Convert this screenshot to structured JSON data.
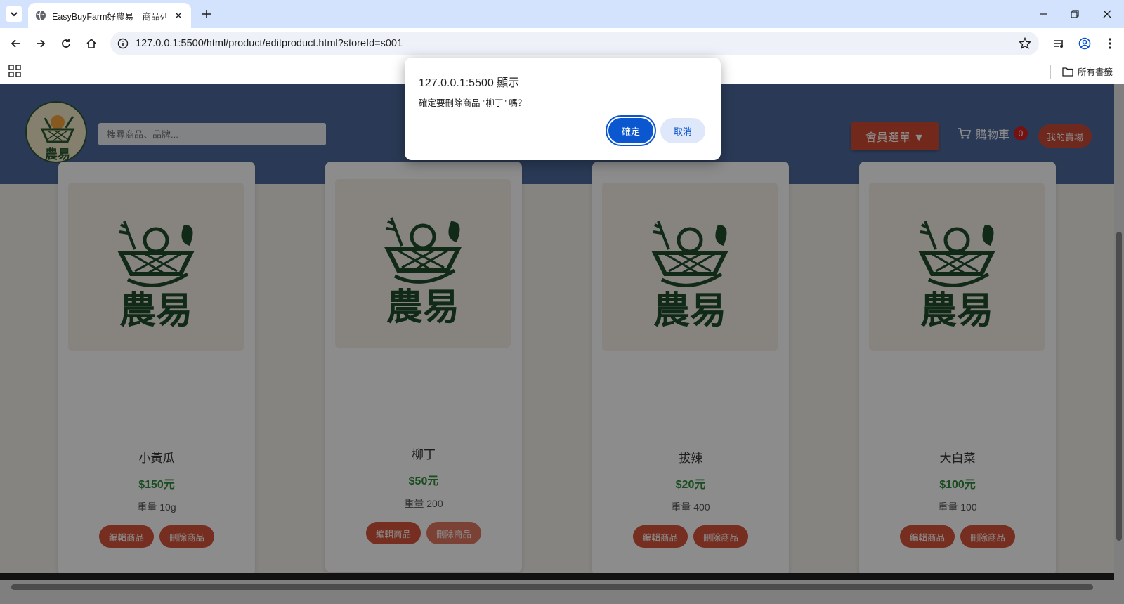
{
  "browser": {
    "tab_title": "EasyBuyFarm好農易｜商品列表",
    "url": "127.0.0.1:5500/html/product/editproduct.html?storeId=s001",
    "bookmark_folder": "所有書籤"
  },
  "header": {
    "logo_text": "農易",
    "search_placeholder": "搜尋商品、品牌...",
    "member_menu": "會員選單 ▼",
    "cart_label": "購物車",
    "cart_count": "0",
    "my_shop": "我的賣場"
  },
  "products": [
    {
      "name": "小黃瓜",
      "price": "$150元",
      "weight": "重量 10g",
      "edit": "編輯商品",
      "delete": "刪除商品",
      "logo": "農易"
    },
    {
      "name": "柳丁",
      "price": "$50元",
      "weight": "重量 200",
      "edit": "編輯商品",
      "delete": "刪除商品",
      "logo": "農易"
    },
    {
      "name": "拔辣",
      "price": "$20元",
      "weight": "重量 400",
      "edit": "編輯商品",
      "delete": "刪除商品",
      "logo": "農易"
    },
    {
      "name": "大白菜",
      "price": "$100元",
      "weight": "重量 100",
      "edit": "編輯商品",
      "delete": "刪除商品",
      "logo": "農易"
    }
  ],
  "dialog": {
    "title": "127.0.0.1:5500 顯示",
    "message": "確定要刪除商品 \"柳丁\" 嗎？",
    "ok": "確定",
    "cancel": "取消"
  },
  "colors": {
    "header_bg": "#4e6b9d",
    "accent_red": "#d6543a",
    "price_green": "#2e8b3a",
    "dialog_primary": "#0b57d0"
  }
}
